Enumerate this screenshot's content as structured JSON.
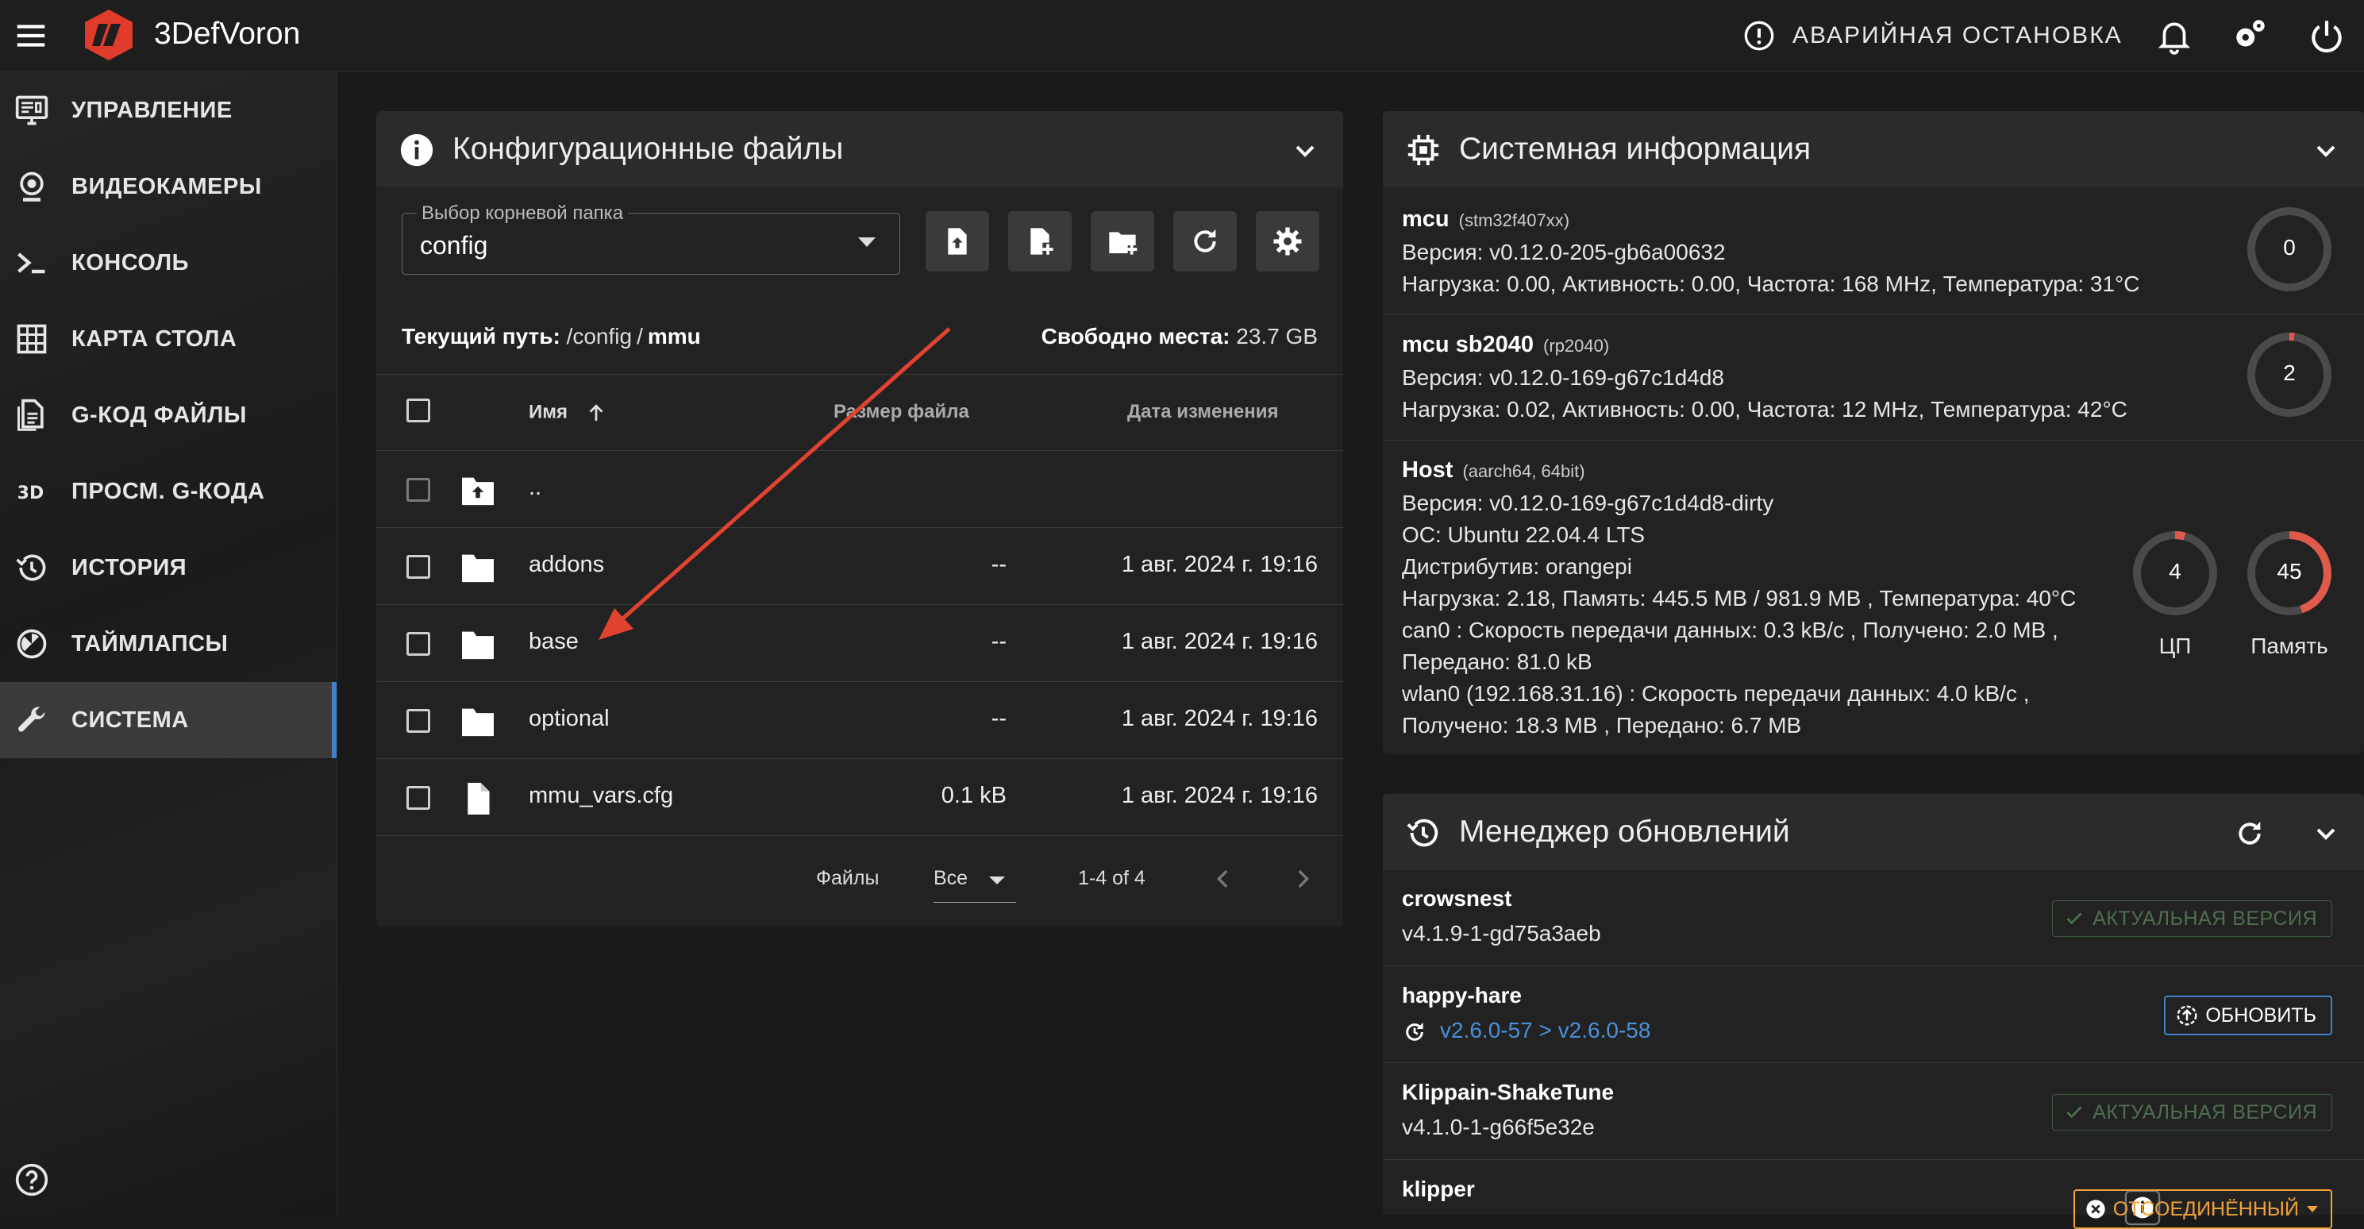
{
  "topbar": {
    "brand": "3DefVoron",
    "estop_label": "АВАРИЙНАЯ ОСТАНОВКА",
    "accent_color": "#e03b2b"
  },
  "sidebar": {
    "items": [
      {
        "label": "УПРАВЛЕНИЕ",
        "icon": "monitor-dashboard-icon"
      },
      {
        "label": "ВИДЕОКАМЕРЫ",
        "icon": "webcam-icon"
      },
      {
        "label": "КОНСОЛЬ",
        "icon": "console-icon"
      },
      {
        "label": "КАРТА СТОЛА",
        "icon": "grid-icon"
      },
      {
        "label": "G-КОД ФАЙЛЫ",
        "icon": "file-document-icon"
      },
      {
        "label": "ПРОСМ. G-КОДА",
        "icon": "3d-icon"
      },
      {
        "label": "ИСТОРИЯ",
        "icon": "history-icon"
      },
      {
        "label": "ТАЙМЛАПСЫ",
        "icon": "timelapse-icon"
      },
      {
        "label": "СИСТЕМА",
        "icon": "wrench-icon",
        "active": true
      }
    ]
  },
  "config_panel": {
    "title": "Конфигурационные файлы",
    "root_select_label": "Выбор корневой папка",
    "root_select_value": "config",
    "path_label": "Текущий путь:",
    "path_root": "/config",
    "path_sep": "/",
    "path_current": "mmu",
    "free_label": "Свободно места:",
    "free_value": "23.7 GB",
    "columns": {
      "name": "Имя",
      "size": "Размер файла",
      "date": "Дата изменения"
    },
    "parent_dir": "..",
    "rows": [
      {
        "name": "addons",
        "type": "folder",
        "size": "--",
        "date": "1 авг. 2024 г. 19:16"
      },
      {
        "name": "base",
        "type": "folder",
        "size": "--",
        "date": "1 авг. 2024 г. 19:16"
      },
      {
        "name": "optional",
        "type": "folder",
        "size": "--",
        "date": "1 авг. 2024 г. 19:16"
      },
      {
        "name": "mmu_vars.cfg",
        "type": "file",
        "size": "0.1 kB",
        "date": "1 авг. 2024 г. 19:16"
      }
    ],
    "footer": {
      "files_label": "Файлы",
      "per_page": "Все",
      "range": "1-4 of 4"
    }
  },
  "sysinfo": {
    "title": "Системная информация",
    "mcu": {
      "name": "mcu",
      "chip": "(stm32f407xx)",
      "version": "Версия: v0.12.0-205-gb6a00632",
      "load": "Нагрузка: 0.00, Активность: 0.00, Частота: 168 MHz, Температура: 31°C",
      "gauge": "0"
    },
    "mcu2": {
      "name": "mcu sb2040",
      "chip": "(rp2040)",
      "version": "Версия: v0.12.0-169-g67c1d4d8",
      "load": "Нагрузка: 0.02, Активность: 0.00, Частота: 12 MHz, Температура: 42°C",
      "gauge": "2"
    },
    "host": {
      "name": "Host",
      "chip": "(aarch64, 64bit)",
      "lines": [
        "Версия: v0.12.0-169-g67c1d4d8-dirty",
        "ОС: Ubuntu 22.04.4 LTS",
        "Дистрибутив: orangepi",
        "Нагрузка: 2.18, Память: 445.5 MB / 981.9 MB , Температура: 40°C",
        "can0 : Скорость передачи данных: 0.3 kB/c , Получено: 2.0 MB ,",
        "Передано: 81.0 kB",
        "wlan0 (192.168.31.16) : Скорость передачи данных: 4.0 kB/c ,",
        "Получено: 18.3 MB , Передано: 6.7 MB"
      ],
      "cpu_value": "4",
      "cpu_label": "ЦП",
      "mem_value": "45",
      "mem_label": "Память"
    }
  },
  "updates": {
    "title": "Менеджер обновлений",
    "items": [
      {
        "name": "crowsnest",
        "version": "v4.1.9-1-gd75a3aeb",
        "status": "АКТУАЛЬНАЯ ВЕРСИЯ"
      },
      {
        "name": "happy-hare",
        "version": "v2.6.0-57 > v2.6.0-58",
        "status": "ОБНОВИТЬ"
      },
      {
        "name": "Klippain-ShakeTune",
        "version": "v4.1.0-1-g66f5e32e",
        "status": "АКТУАЛЬНАЯ ВЕРСИЯ"
      },
      {
        "name": "klipper",
        "version": "",
        "status": "ОТСОЕДИНЁННЫЙ"
      }
    ]
  }
}
